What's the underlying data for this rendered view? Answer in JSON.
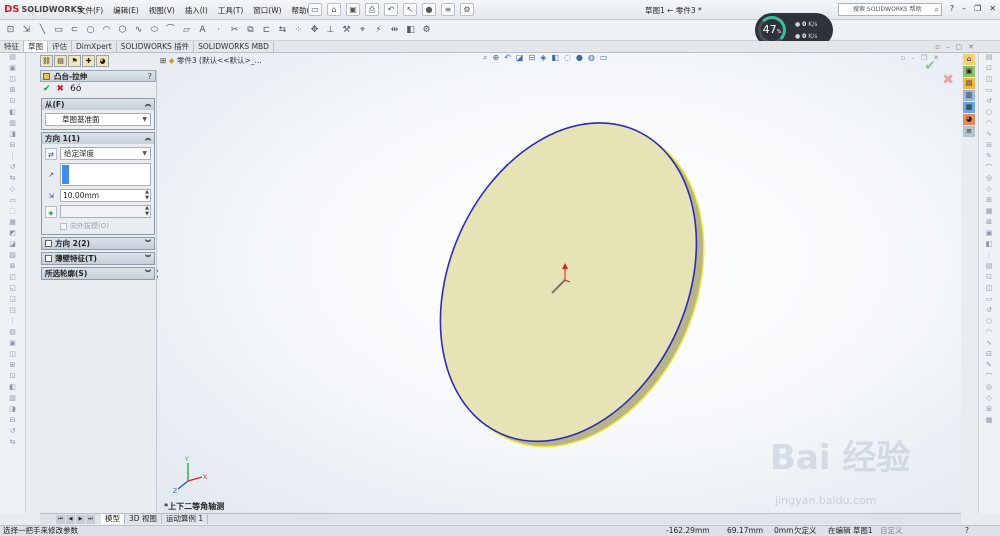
{
  "app": {
    "logo_text": "SOLIDWORKS",
    "logo_prefix": "DS",
    "doc_title": "草图1 ← 零件3 *",
    "menu": [
      "文件(F)",
      "编辑(E)",
      "视图(V)",
      "插入(I)",
      "工具(T)",
      "窗口(W)",
      "帮助(H)"
    ],
    "search_placeholder": "搜索 SOLIDWORKS 帮助"
  },
  "perf_widget": {
    "percent": "47",
    "unit": "%",
    "row1": "0",
    "row1_unit": "K/s",
    "row2": "0",
    "row2_unit": "K/s"
  },
  "command_tabs": [
    "特征",
    "草图",
    "评估",
    "DimXpert",
    "SOLIDWORKS 插件",
    "SOLIDWORKS MBD"
  ],
  "active_command_tab": "草图",
  "property_manager": {
    "title": "凸台-拉伸",
    "from_group": {
      "label": "从(F)",
      "value": "草图基准面"
    },
    "direction1": {
      "label": "方向 1(1)",
      "end_condition": "给定深度",
      "depth": "10.00mm",
      "draft_outward": "向外拔模(O)"
    },
    "direction2": {
      "label": "方向 2(2)"
    },
    "thin_feature": {
      "label": "薄壁特征(T)"
    },
    "selected_contours": {
      "label": "所选轮廓(S)"
    }
  },
  "viewport": {
    "tree_item": "零件3  (默认<<默认>_...",
    "view_name": "*上下二等角轴测"
  },
  "bottom_tabs": [
    "模型",
    "3D 视图",
    "运动算例 1"
  ],
  "active_bottom_tab": "模型",
  "status": {
    "message": "选择一把手来修改参数",
    "x": "-162.29mm",
    "y": "69.17mm",
    "z": "0mm",
    "defined": "欠定义",
    "editing": "在编辑 草图1",
    "custom": "自定义"
  },
  "watermark": {
    "main": "Bai 经验",
    "url": "jingyan.baidu.com"
  },
  "colors": {
    "disc_face": "#e6e3b6",
    "disc_edge": "#2b2fb0",
    "disc_highlight": "#f2ee3a",
    "ok": "#1a9b2c",
    "cancel": "#c8202a"
  }
}
